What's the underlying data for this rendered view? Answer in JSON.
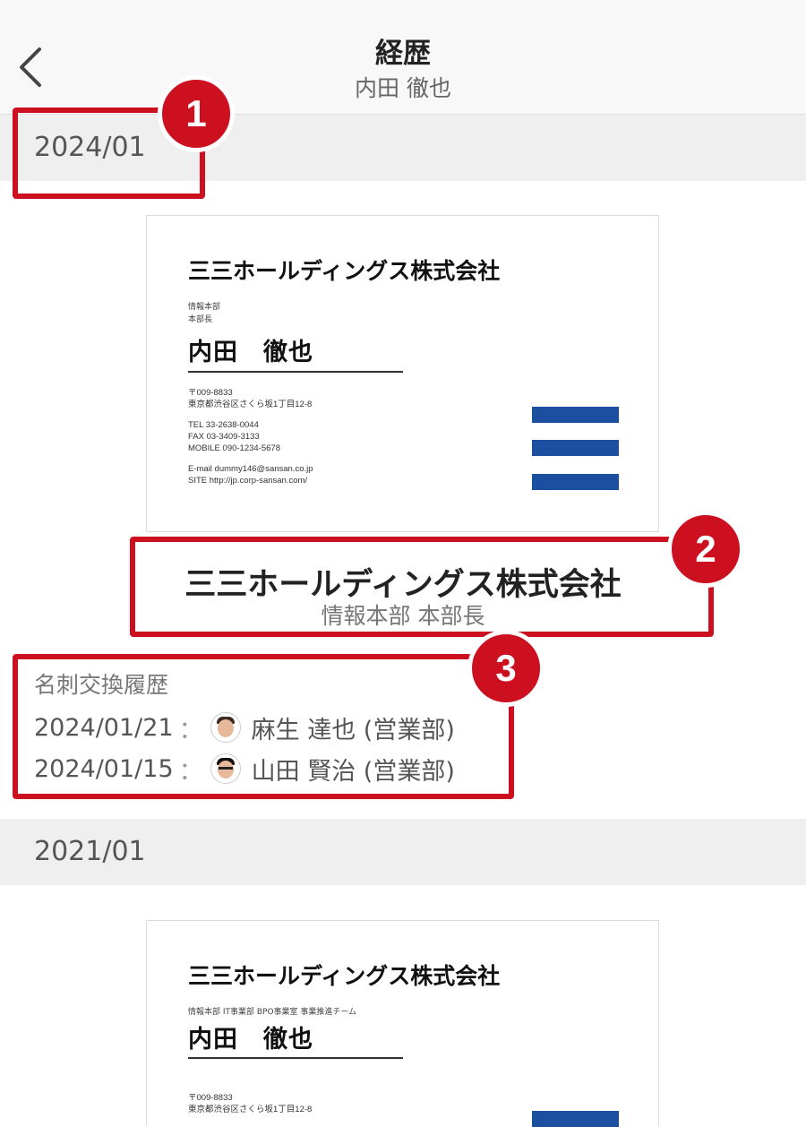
{
  "header": {
    "title": "経歴",
    "subtitle": "内田 徹也"
  },
  "entries": [
    {
      "year": "2024/01",
      "card": {
        "company": "三三ホールディングス株式会社",
        "dept_lines": [
          "情報本部",
          "本部長"
        ],
        "name": "内田　徹也",
        "address_lines": [
          "〒009-8833",
          "東京都渋谷区さくら坂1丁目12-8"
        ],
        "contact_lines": [
          "TEL 33-2638-0044",
          "FAX 03-3409-3133",
          "MOBILE 090-1234-5678"
        ],
        "web_lines": [
          "E-mail dummy146@sansan.co.jp",
          "SITE http://jp.corp-sansan.com/"
        ]
      },
      "company_name": "三三ホールディングス株式会社",
      "position": "情報本部 本部長",
      "history": {
        "heading": "名刺交換履歴",
        "rows": [
          {
            "date": "2024/01/21",
            "separator": "：",
            "person": "麻生 達也 (営業部)"
          },
          {
            "date": "2024/01/15",
            "separator": "：",
            "person": "山田 賢治 (営業部)"
          }
        ]
      }
    },
    {
      "year": "2021/01",
      "card": {
        "company": "三三ホールディングス株式会社",
        "dept_line": "情報本部 IT事業部 BPO事業室 事業推進チーム",
        "name": "内田　徹也",
        "address_lines": [
          "〒009-8833",
          "東京都渋谷区さくら坂1丁目12-8"
        ]
      }
    }
  ],
  "annotations": [
    "1",
    "2",
    "3"
  ],
  "colors": {
    "accent": "#cc1020",
    "card_logo": "#1c4fa0",
    "section_bg": "#efefef"
  }
}
